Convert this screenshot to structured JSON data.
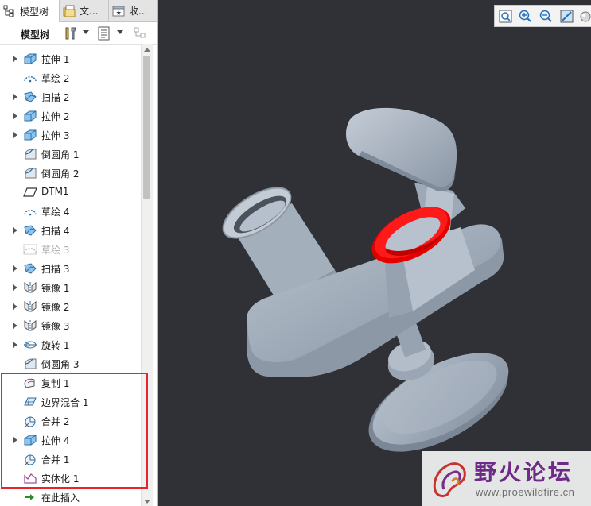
{
  "tabs": [
    {
      "label": "模型树",
      "icon": "model-tree-icon",
      "active": true
    },
    {
      "label": "文...",
      "icon": "folder-browser-icon",
      "active": false
    },
    {
      "label": "收...",
      "icon": "favorites-icon",
      "active": false
    }
  ],
  "toolbar": {
    "title": "模型树",
    "buttons": [
      "settings-tools-icon",
      "show-list-icon",
      "filter-icon"
    ]
  },
  "tree_items": [
    {
      "label": "拉伸 1",
      "icon": "extrude-icon",
      "expandable": true
    },
    {
      "label": "草绘 2",
      "icon": "sketch-icon",
      "expandable": false
    },
    {
      "label": "扫描 2",
      "icon": "sweep-icon",
      "expandable": true
    },
    {
      "label": "拉伸 2",
      "icon": "extrude-icon",
      "expandable": true
    },
    {
      "label": "拉伸 3",
      "icon": "extrude-icon",
      "expandable": true
    },
    {
      "label": "倒圆角 1",
      "icon": "round-icon",
      "expandable": false
    },
    {
      "label": "倒圆角 2",
      "icon": "round-icon",
      "expandable": false
    },
    {
      "label": "DTM1",
      "icon": "datum-plane-icon",
      "expandable": false
    },
    {
      "label": "草绘 4",
      "icon": "sketch-icon",
      "expandable": false
    },
    {
      "label": "扫描 4",
      "icon": "sweep-icon",
      "expandable": true
    },
    {
      "label": "草绘 3",
      "icon": "sketch-hidden-icon",
      "expandable": false,
      "dim": true
    },
    {
      "label": "扫描 3",
      "icon": "sweep-icon",
      "expandable": true
    },
    {
      "label": "镜像 1",
      "icon": "mirror-icon",
      "expandable": true
    },
    {
      "label": "镜像 2",
      "icon": "mirror-icon",
      "expandable": true
    },
    {
      "label": "镜像 3",
      "icon": "mirror-icon",
      "expandable": true
    },
    {
      "label": "旋转 1",
      "icon": "revolve-icon",
      "expandable": true
    },
    {
      "label": "倒圆角 3",
      "icon": "round-icon",
      "expandable": false
    },
    {
      "label": "复制 1",
      "icon": "copy-surface-icon",
      "expandable": false
    },
    {
      "label": "边界混合 1",
      "icon": "boundary-blend-icon",
      "expandable": false
    },
    {
      "label": "合并 2",
      "icon": "merge-icon",
      "expandable": false
    },
    {
      "label": "拉伸 4",
      "icon": "extrude-icon",
      "expandable": true
    },
    {
      "label": "合并 1",
      "icon": "merge-icon",
      "expandable": false
    },
    {
      "label": "实体化 1",
      "icon": "solidify-icon",
      "expandable": false
    },
    {
      "label": "在此插入",
      "icon": "insert-here-arrow-icon",
      "expandable": false
    }
  ],
  "view_toolbar": [
    "refit-icon",
    "zoom-in-icon",
    "zoom-out-icon",
    "repaint-icon",
    "shading-icon"
  ],
  "watermark": {
    "title": "野火论坛",
    "url": "www.proewildfire.cn"
  },
  "colors": {
    "viewport_bg": "#2f3136",
    "model": "#a9b4c1",
    "highlight_surface": "#ff0000",
    "selection_box": "#e8242a"
  }
}
